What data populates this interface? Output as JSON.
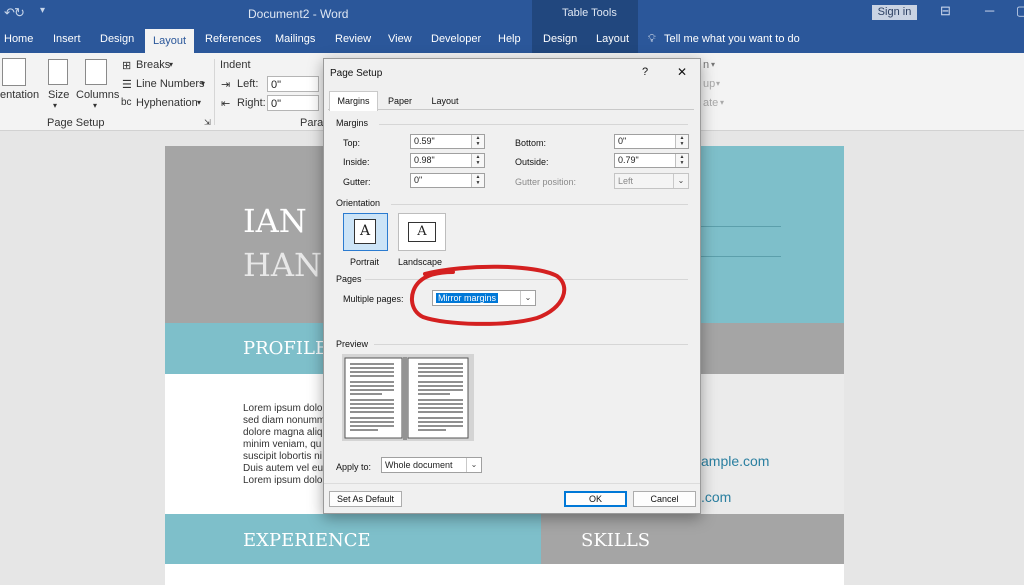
{
  "window": {
    "doc_title": "Document2 - Word",
    "table_tools": "Table Tools",
    "sign_in": "Sign in",
    "tabs": [
      "Home",
      "Insert",
      "Design",
      "Layout",
      "References",
      "Mailings",
      "Review",
      "View",
      "Developer",
      "Help",
      "Design",
      "Layout"
    ],
    "active_tab": "Layout",
    "tell_me": "Tell me what you want to do"
  },
  "ribbon": {
    "orientation": "entation",
    "size": "Size",
    "columns": "Columns",
    "breaks": "Breaks",
    "line_numbers": "Line Numbers",
    "hyphenation": "Hyphenation",
    "group_page_setup": "Page Setup",
    "indent": "Indent",
    "left_label": "Left:",
    "left_value": "0\"",
    "right_label": "Right:",
    "right_value": "0\"",
    "group_paragraph": "Parag",
    "right_cut_1": "n",
    "right_cut_2": "up",
    "right_cut_3": "ate"
  },
  "document": {
    "name_line1": "IAN",
    "name_line2": "HAN",
    "profile": "PROFILE",
    "lorem": [
      "Lorem ipsum dolo",
      "sed diam nonumm",
      "dolore magna aliq",
      "minim veniam, qu",
      "suscipit lobortis ni",
      "Duis autem vel eu",
      "Lorem ipsum dolo"
    ],
    "email_fragment": "ample.com",
    "web_fragment": ".com",
    "experience": "EXPERIENCE",
    "skills": "SKILLS"
  },
  "dialog": {
    "title": "Page Setup",
    "help": "?",
    "close": "✕",
    "tabs": [
      "Margins",
      "Paper",
      "Layout"
    ],
    "active_tab": "Margins",
    "margins_section": "Margins",
    "top_label": "Top:",
    "top_value": "0.59\"",
    "bottom_label": "Bottom:",
    "bottom_value": "0\"",
    "inside_label": "Inside:",
    "inside_value": "0.98\"",
    "outside_label": "Outside:",
    "outside_value": "0.79\"",
    "gutter_label": "Gutter:",
    "gutter_value": "0\"",
    "gutter_position_label": "Gutter position:",
    "gutter_position_value": "Left",
    "orientation_section": "Orientation",
    "portrait": "Portrait",
    "landscape": "Landscape",
    "orientation_glyph": "A",
    "pages_section": "Pages",
    "multiple_pages_label": "Multiple pages:",
    "multiple_pages_value": "Mirror margins",
    "preview_section": "Preview",
    "apply_to_label": "Apply to:",
    "apply_to_value": "Whole document",
    "set_default": "Set As Default",
    "ok": "OK",
    "cancel": "Cancel"
  },
  "colors": {
    "title_bar": "#2b579a",
    "teal_band": "#7ebfca",
    "gray_band": "#a5a5a5",
    "annotation_red": "#d42020",
    "selection": "#0078d7"
  }
}
